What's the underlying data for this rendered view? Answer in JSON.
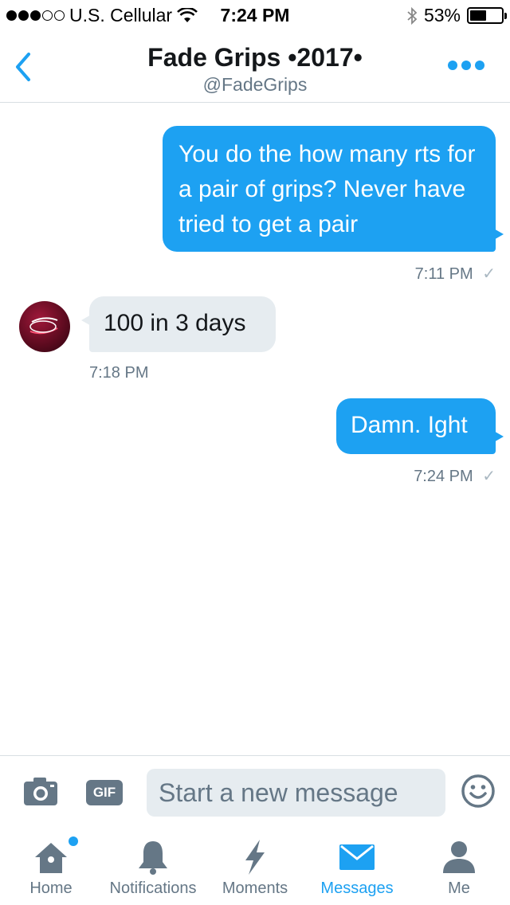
{
  "status_bar": {
    "carrier": "U.S. Cellular",
    "time": "7:24 PM",
    "battery": "53%",
    "battery_level": 0.53,
    "signal_bars_filled": 3,
    "signal_bars_total": 5
  },
  "header": {
    "title": "Fade Grips •2017•",
    "handle": "@FadeGrips"
  },
  "messages": [
    {
      "direction": "out",
      "text": "You do the how many rts for a pair of grips? Never have tried to get a pair",
      "time": "7:11 PM",
      "read": "✓"
    },
    {
      "direction": "in",
      "text": "100 in 3 days",
      "time": "7:18 PM"
    },
    {
      "direction": "out",
      "text": "Damn. Ight",
      "time": "7:24 PM",
      "read": "✓"
    }
  ],
  "composer": {
    "gif_label": "GIF",
    "placeholder": "Start a new message"
  },
  "tabs": [
    {
      "label": "Home",
      "icon": "home-icon",
      "active": false,
      "badge": true
    },
    {
      "label": "Notifications",
      "icon": "bell-icon",
      "active": false
    },
    {
      "label": "Moments",
      "icon": "lightning-icon",
      "active": false
    },
    {
      "label": "Messages",
      "icon": "envelope-icon",
      "active": true
    },
    {
      "label": "Me",
      "icon": "person-icon",
      "active": false
    }
  ],
  "colors": {
    "accent": "#1da1f2",
    "bubble_in": "#e6ecf0",
    "secondary_text": "#657786"
  }
}
